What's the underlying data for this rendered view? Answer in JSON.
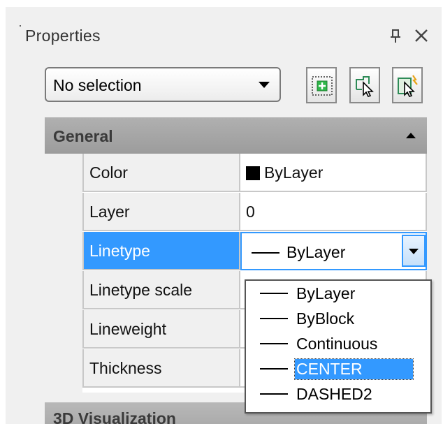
{
  "panel": {
    "title": "Properties"
  },
  "selector": {
    "value": "No selection"
  },
  "toolbar": {
    "icons": [
      "quick-select-icon",
      "select-objects-icon",
      "toggle-pickadd-icon"
    ]
  },
  "category": {
    "label": "General"
  },
  "properties": [
    {
      "name": "Color",
      "value": "ByLayer"
    },
    {
      "name": "Layer",
      "value": "0"
    },
    {
      "name": "Linetype",
      "value": "ByLayer"
    },
    {
      "name": "Linetype scale",
      "value": ""
    },
    {
      "name": "Lineweight",
      "value": ""
    },
    {
      "name": "Thickness",
      "value": ""
    }
  ],
  "linetype_dropdown": {
    "options": [
      "ByLayer",
      "ByBlock",
      "Continuous",
      "CENTER",
      "DASHED2"
    ],
    "highlighted": "CENTER"
  },
  "next_category": {
    "label": "3D Visualization"
  },
  "colors": {
    "selection": "#3399ff",
    "category_bg": "#a6a6a6",
    "panel_bg": "#f0f0f0"
  }
}
